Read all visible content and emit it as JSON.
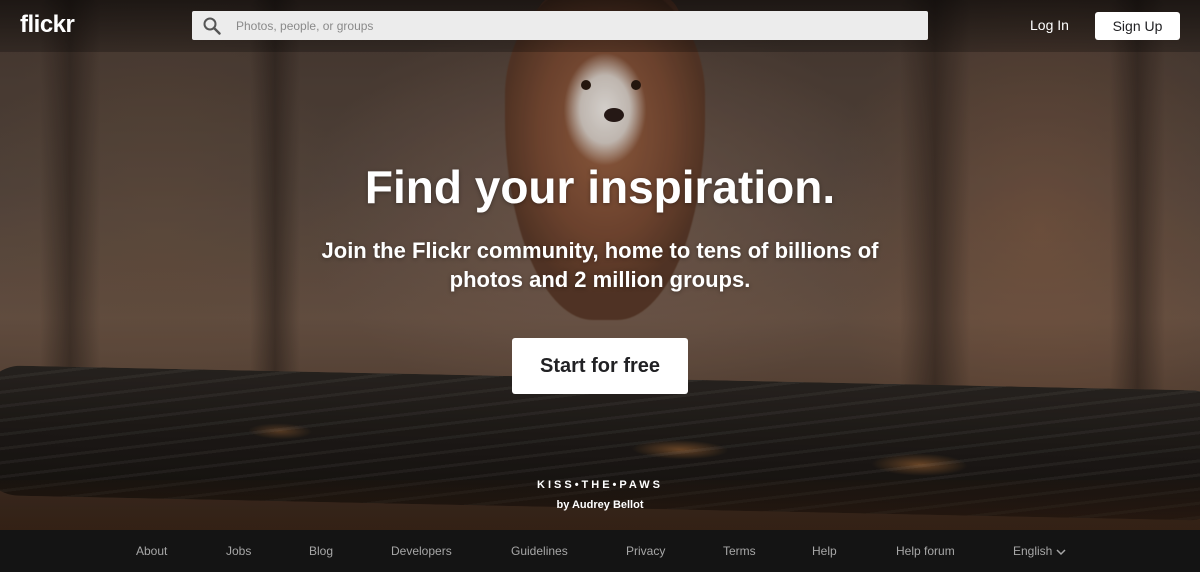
{
  "header": {
    "logo": "flickr",
    "search_placeholder": "Photos, people, or groups",
    "login_label": "Log In",
    "signup_label": "Sign Up"
  },
  "hero": {
    "title": "Find your inspiration.",
    "subtitle": "Join the Flickr community, home to tens of billions of photos and 2 million groups.",
    "cta_label": "Start for free",
    "photo_title": "KISS•THE•PAWS",
    "photo_author": "by Audrey Bellot"
  },
  "footer": {
    "links": [
      "About",
      "Jobs",
      "Blog",
      "Developers",
      "Guidelines",
      "Privacy",
      "Terms",
      "Help",
      "Help forum"
    ],
    "language": "English"
  },
  "colors": {
    "button_bg": "#ffffff",
    "button_text": "#212124",
    "footer_bg": "#141414",
    "footer_text": "#a7a7a7",
    "search_bg": "#ececec"
  }
}
